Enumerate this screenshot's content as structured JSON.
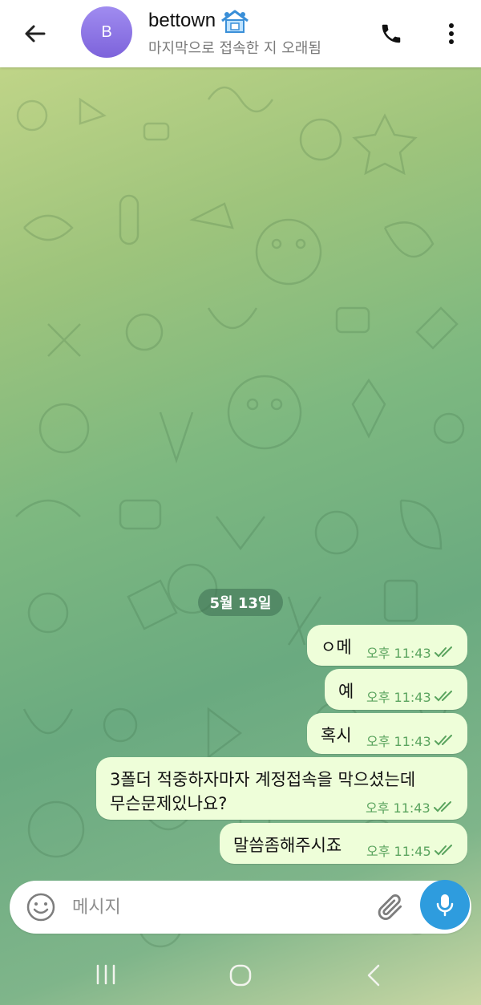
{
  "header": {
    "avatar_letter": "B",
    "contact_name": "bettown",
    "status": "마지막으로 접속한 지 오래됨",
    "icons": {
      "back": "arrow-left-icon",
      "call": "phone-icon",
      "more": "more-vertical-icon",
      "name_badge": "house-emoji-icon"
    }
  },
  "chat": {
    "date_label": "5월 13일",
    "messages": [
      {
        "text": "ㅇ메",
        "time": "오후 11:43",
        "status": "read"
      },
      {
        "text": "예",
        "time": "오후 11:43",
        "status": "read"
      },
      {
        "text": "혹시",
        "time": "오후 11:43",
        "status": "read"
      },
      {
        "text_line1": "3폴더 적중하자마자 계정접속을 막으셨는데",
        "text_line2": "무슨문제있나요?",
        "time": "오후 11:43",
        "status": "read"
      },
      {
        "text": "말씀좀해주시죠",
        "time": "오후 11:45",
        "status": "read"
      }
    ]
  },
  "composer": {
    "placeholder": "메시지",
    "icons": {
      "emoji": "smiley-icon",
      "attach": "paperclip-icon",
      "mic": "microphone-icon"
    }
  },
  "navbar": {
    "icons": {
      "recents": "recents-icon",
      "home": "home-icon",
      "back": "back-chevron-icon"
    }
  },
  "colors": {
    "bubble": "#eefed9",
    "check": "#5aa45e",
    "mic": "#2e9cde",
    "avatar": "#8a72e4"
  }
}
